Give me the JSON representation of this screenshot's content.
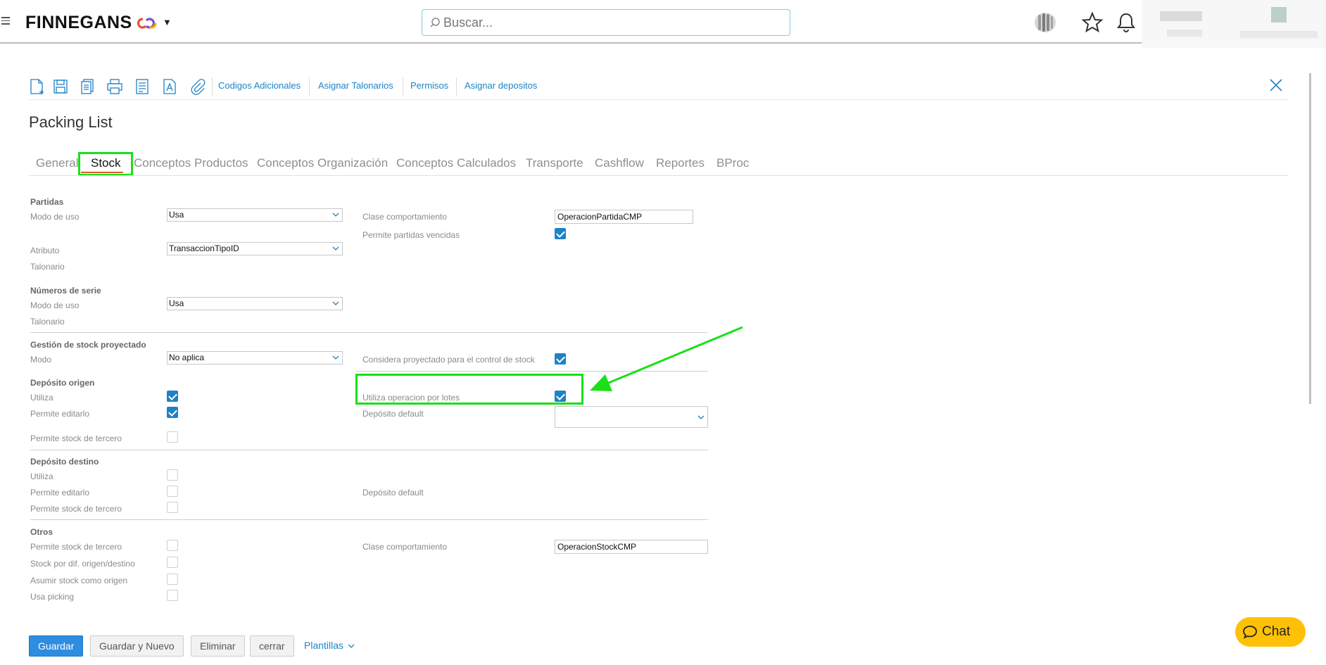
{
  "header": {
    "logo_text": "FINNEGANS",
    "search_placeholder": "Buscar..."
  },
  "toolbar": {
    "links": [
      "Codigos Adicionales",
      "Asignar Talonarios",
      "Permisos",
      "Asignar depositos"
    ]
  },
  "page": {
    "title": "Packing List",
    "tabs": [
      "General",
      "Stock",
      "Conceptos Productos",
      "Conceptos Organización",
      "Conceptos Calculados",
      "Transporte",
      "Cashflow",
      "Reportes",
      "BProc"
    ],
    "active_tab": "Stock"
  },
  "form": {
    "partidas": {
      "title": "Partidas",
      "modo_uso_label": "Modo de uso",
      "modo_uso_value": "Usa",
      "clase_label": "Clase comportamiento",
      "clase_value": "OperacionPartidaCMP",
      "vencidas_label": "Permite partidas vencidas",
      "vencidas_checked": true,
      "atributo_label": "Atributo",
      "atributo_value": "TransaccionTipoID",
      "talonario_label": "Talonario"
    },
    "series": {
      "title": "Números de serie",
      "modo_uso_label": "Modo de uso",
      "modo_uso_value": "Usa",
      "talonario_label": "Talonario"
    },
    "proyectado": {
      "title": "Gestión de stock proyectado",
      "modo_label": "Modo",
      "modo_value": "No aplica",
      "considera_label": "Considera proyectado para el control de stock",
      "considera_checked": true
    },
    "origen": {
      "title": "Depósito origen",
      "utiliza_label": "Utiliza",
      "utiliza_checked": true,
      "lotes_label": "Utiliza operacion por lotes",
      "lotes_checked": true,
      "editar_label": "Permite editarlo",
      "editar_checked": true,
      "default_label": "Depósito default",
      "tercero_label": "Permite stock de tercero",
      "tercero_checked": false
    },
    "destino": {
      "title": "Depósito destino",
      "utiliza_label": "Utiliza",
      "editar_label": "Permite editarlo",
      "default_label": "Depósito default",
      "tercero_label": "Permite stock de tercero"
    },
    "otros": {
      "title": "Otros",
      "tercero_label": "Permite stock de tercero",
      "clase_label": "Clase comportamiento",
      "clase_value": "OperacionStockCMP",
      "dif_label": "Stock por dif. origen/destino",
      "asumir_label": "Asumir stock como origen",
      "picking_label": "Usa picking"
    }
  },
  "footer": {
    "guardar": "Guardar",
    "guardar_nuevo": "Guardar y Nuevo",
    "eliminar": "Eliminar",
    "cerrar": "cerrar",
    "plantillas": "Plantillas"
  },
  "chat": {
    "label": "Chat"
  },
  "colors": {
    "accent": "#1d83c6",
    "highlight": "#19e019",
    "tab_underline": "#e0592a",
    "chat": "#ffc107"
  }
}
